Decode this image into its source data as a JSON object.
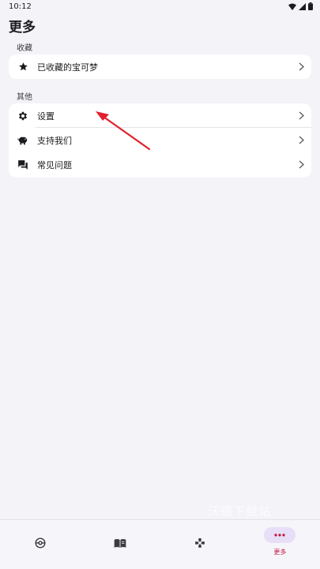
{
  "status_bar": {
    "time": "10:12"
  },
  "page": {
    "title": "更多"
  },
  "sections": {
    "favorites": {
      "label": "收藏",
      "items": [
        {
          "label": "已收藏的宝可梦",
          "icon": "star-icon"
        }
      ]
    },
    "other": {
      "label": "其他",
      "items": [
        {
          "label": "设置",
          "icon": "gear-icon"
        },
        {
          "label": "支持我们",
          "icon": "piggy-bank-icon"
        },
        {
          "label": "常见问题",
          "icon": "chat-bubbles-icon"
        }
      ]
    }
  },
  "bottom_nav": {
    "items": [
      {
        "icon": "pokeball-icon",
        "label": ""
      },
      {
        "icon": "book-icon",
        "label": ""
      },
      {
        "icon": "gamepad-icon",
        "label": ""
      },
      {
        "icon": "more-dots-icon",
        "label": "更多",
        "active": true
      }
    ]
  },
  "watermark": "沃德下载站",
  "colors": {
    "accent": "#c0143c",
    "active_pill": "#e6dff7",
    "background": "#f4f3f8",
    "arrow": "#e0202e"
  }
}
